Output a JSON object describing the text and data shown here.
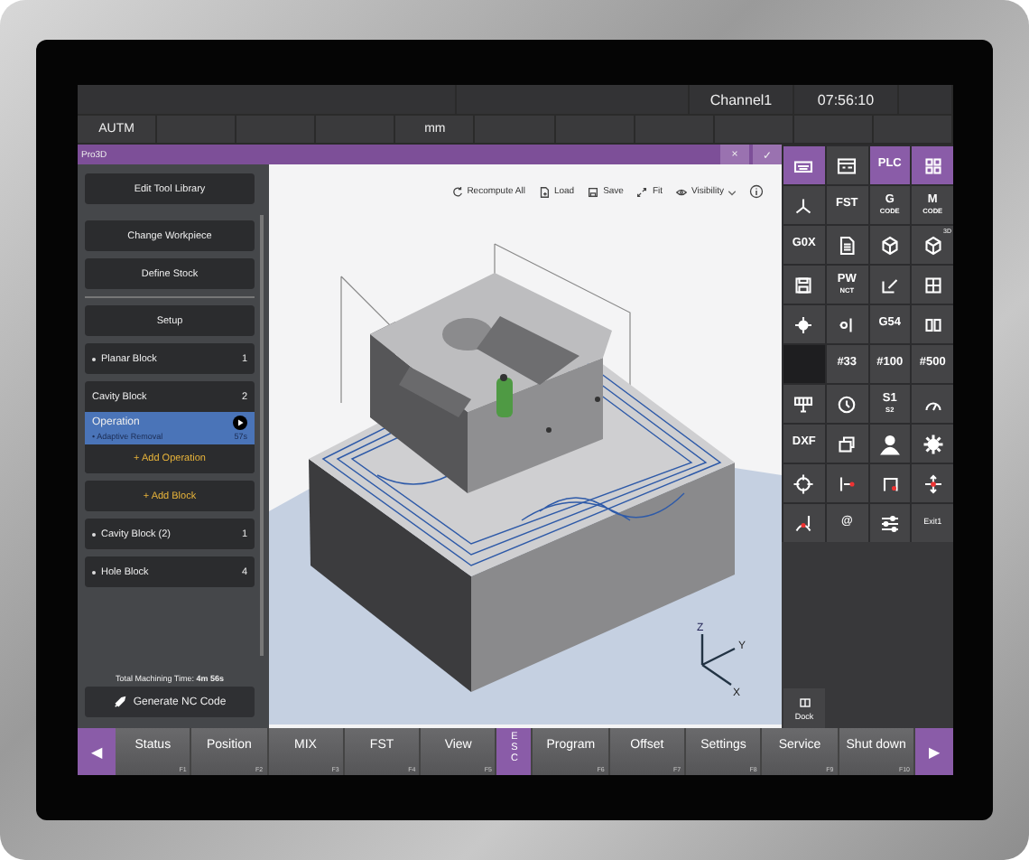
{
  "header": {
    "channel": "Channel1",
    "time": "07:56:10",
    "mode": "AUTM",
    "unit": "mm"
  },
  "window": {
    "title": "Pro3D",
    "buttons": [
      "×",
      "✓"
    ]
  },
  "side_panel": {
    "items": [
      {
        "kind": "action",
        "label": "Edit Tool Library"
      },
      {
        "kind": "action",
        "label": "Change Workpiece"
      },
      {
        "kind": "action",
        "label": "Define Stock"
      },
      {
        "kind": "setup",
        "label": "Setup"
      },
      {
        "kind": "block",
        "label": "Planar Block",
        "count": "1",
        "expanded": false
      },
      {
        "kind": "block",
        "label": "Cavity Block",
        "count": "2",
        "expanded": true,
        "operations": [
          {
            "label": "Operation",
            "detail": "• Adaptive Removal",
            "time": "57s",
            "selected": true
          }
        ],
        "add_label": "+ Add Operation"
      },
      {
        "kind": "add",
        "label": "+ Add Block"
      },
      {
        "kind": "block",
        "label": "Cavity Block (2)",
        "count": "1",
        "expanded": false
      },
      {
        "kind": "block",
        "label": "Hole Block",
        "count": "4",
        "expanded": false
      }
    ],
    "total": "Total Machining Time: **4m 56s**",
    "generate": "Generate NC Code"
  },
  "viewport": {
    "toolbar": [
      {
        "label": "Recompute All"
      },
      {
        "label": "Load"
      },
      {
        "label": "Save"
      },
      {
        "label": "Fit"
      },
      {
        "label": "Visibility",
        "dropdown": true
      }
    ],
    "axes": [
      "X",
      "Y",
      "Z"
    ]
  },
  "tiles": [
    {
      "kind": "icon",
      "active": true
    },
    {
      "kind": "icon",
      "active": false
    },
    {
      "kind": "text",
      "label": "PLC",
      "active": true
    },
    {
      "kind": "icon",
      "active": true
    },
    {
      "kind": "icon",
      "active": false
    },
    {
      "kind": "text",
      "label": "FST",
      "active": false
    },
    {
      "kind": "text",
      "label": "G",
      "sub": "CODE",
      "active": false
    },
    {
      "kind": "text",
      "label": "M",
      "sub": "CODE",
      "active": false
    },
    {
      "kind": "text",
      "label": "G0X",
      "active": false
    },
    {
      "kind": "icon",
      "active": false
    },
    {
      "kind": "icon",
      "active": false
    },
    {
      "kind": "icon",
      "badge": "3D",
      "active": false
    },
    {
      "kind": "icon",
      "active": false
    },
    {
      "kind": "text",
      "label": "PW",
      "sub": "NCT",
      "active": false
    },
    {
      "kind": "icon",
      "active": false
    },
    {
      "kind": "icon",
      "active": false
    },
    {
      "kind": "icon",
      "active": false
    },
    {
      "kind": "icon",
      "active": false
    },
    {
      "kind": "text",
      "label": "G54",
      "active": false
    },
    {
      "kind": "icon",
      "active": false
    },
    {
      "kind": "blank",
      "active": false
    },
    {
      "kind": "text",
      "label": "#33",
      "active": false
    },
    {
      "kind": "text",
      "label": "#100",
      "active": false
    },
    {
      "kind": "text",
      "label": "#500",
      "active": false
    },
    {
      "kind": "icon",
      "active": false
    },
    {
      "kind": "icon",
      "active": false
    },
    {
      "kind": "text",
      "label": "S1",
      "sub": "S2",
      "active": false
    },
    {
      "kind": "icon",
      "active": false
    },
    {
      "kind": "text",
      "label": "DXF",
      "active": false
    },
    {
      "kind": "icon",
      "active": false
    },
    {
      "kind": "icon",
      "active": false
    },
    {
      "kind": "icon",
      "active": false
    },
    {
      "kind": "icon",
      "active": false
    },
    {
      "kind": "icon",
      "active": false
    },
    {
      "kind": "icon",
      "active": false
    },
    {
      "kind": "icon",
      "active": false
    },
    {
      "kind": "icon",
      "active": false
    },
    {
      "kind": "text",
      "label": "@",
      "active": false
    },
    {
      "kind": "icon",
      "active": false
    },
    {
      "kind": "text",
      "label": "Exit1",
      "small": true,
      "active": false
    }
  ],
  "dock": {
    "label": "Dock"
  },
  "softkeys": [
    {
      "kind": "key",
      "label": "Status",
      "fkey": "F1",
      "active": false
    },
    {
      "kind": "key",
      "label": "Position",
      "fkey": "F2",
      "active": false
    },
    {
      "kind": "key",
      "label": "MIX",
      "fkey": "F3",
      "active": false
    },
    {
      "kind": "key",
      "label": "FST",
      "fkey": "F4",
      "active": false
    },
    {
      "kind": "key",
      "label": "View",
      "fkey": "F5",
      "active": false
    },
    {
      "kind": "vertical",
      "label": "ESC",
      "active": true
    },
    {
      "kind": "key",
      "label": "Program",
      "fkey": "F6",
      "active": false
    },
    {
      "kind": "key",
      "label": "Offset",
      "fkey": "F7",
      "active": false
    },
    {
      "kind": "key",
      "label": "Settings",
      "fkey": "F8",
      "active": false
    },
    {
      "kind": "key",
      "label": "Service",
      "fkey": "F9",
      "active": false
    },
    {
      "kind": "key",
      "label": "Shut down",
      "fkey": "F10",
      "active": false
    }
  ],
  "nav": {
    "prev": "◀",
    "next": "▶"
  }
}
